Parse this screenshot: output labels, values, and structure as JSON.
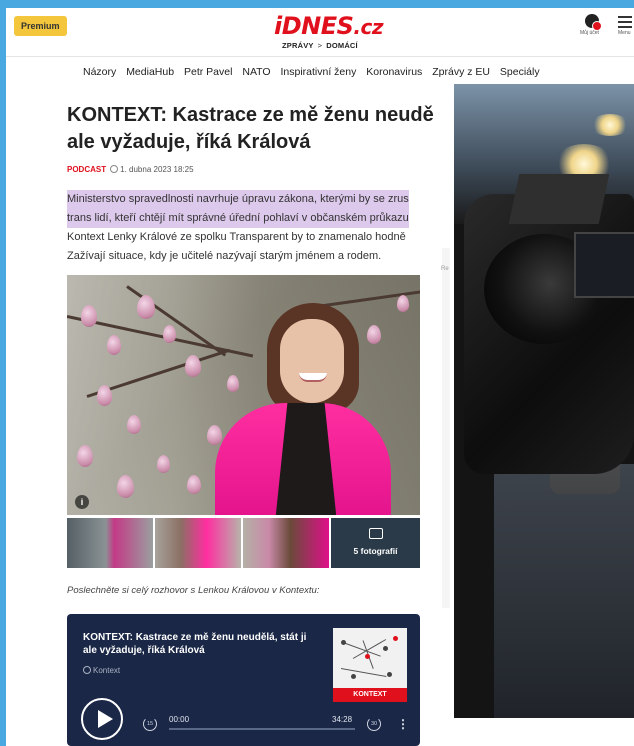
{
  "header": {
    "premium_label": "Premium",
    "logo_text": "iDNES",
    "logo_suffix": ".cz",
    "breadcrumb": [
      "ZPRÁVY",
      "DOMÁCÍ"
    ],
    "breadcrumb_separator": ">",
    "user_label": "Můj účet",
    "menu_label": "Menu",
    "brand_color": "#e0101c"
  },
  "nav": {
    "items": [
      "Názory",
      "MediaHub",
      "Petr Pavel",
      "NATO",
      "Inspirativní ženy",
      "Koronavirus",
      "Zprávy z EU",
      "Speciály"
    ]
  },
  "article": {
    "headline_line1": "KONTEXT: Kastrace ze mě ženu neudě",
    "headline_line2": "ale vyžaduje, říká Králová",
    "category": "PODCAST",
    "date": "1. dubna 2023 18:25",
    "perex_highlight_1": "Ministerstvo spravedlnosti navrhuje úpravu zákona, kterými by se zrus",
    "perex_highlight_2": "trans lidí, kteří chtějí mít správné úřední pohlaví v občanském průkazu",
    "perex_line3": "Kontext Lenky Králové ze spolku Transparent by to znamenalo hodně",
    "perex_line4": "Zažívají situace, kdy je učitelé nazývají starým jménem a rodem.",
    "highlight_color": "#ddc9ec",
    "gallery_count": "5 fotografií",
    "info_icon": "i",
    "listen_text": "Poslechněte si celý rozhovor s Lenkou Královou v Kontextu:"
  },
  "player": {
    "title": "KONTEXT: Kastrace ze mě ženu neudělá, stát ji ale vyžaduje, říká Králová",
    "source": "Kontext",
    "cover_label": "KONTEXT",
    "rewind_label": "15",
    "forward_label": "30",
    "time_current": "00:00",
    "time_total": "34:28",
    "progress": 0,
    "more": "⋮",
    "background_color": "#1a2746"
  },
  "side": {
    "letter": "Re"
  }
}
